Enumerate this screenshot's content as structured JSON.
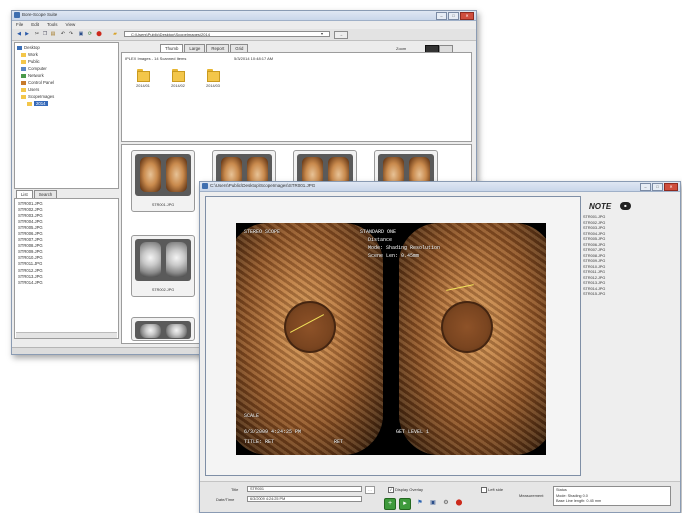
{
  "browser": {
    "title": "Bore-Scope Suite",
    "menu": [
      "File",
      "Edit",
      "Tools",
      "View"
    ],
    "path": "C:\\Users\\Public\\Desktop\\ScopeImages\\2014",
    "tabs": [
      "Thumb",
      "Large",
      "Report",
      "Grid"
    ],
    "status_line": "IPLEX Images - 14 Scanned Items",
    "timestamp": "5/3/2014 10:48:17 AM",
    "view_label": "Zoom",
    "tree": [
      "Desktop",
      "Work",
      "Public",
      "Computer",
      "Network",
      "Control Panel",
      "Users",
      "ScopeImages",
      "2014"
    ],
    "left_tabs": [
      "List",
      "Search"
    ],
    "file_list": [
      "STR001.JPG",
      "STR002.JPG",
      "STR003.JPG",
      "STR004.JPG",
      "STR005.JPG",
      "STR006.JPG",
      "STR007.JPG",
      "STR008.JPG",
      "STR009.JPG",
      "STR010.JPG",
      "STR011.JPG",
      "STR012.JPG",
      "STR013.JPG",
      "STR014.JPG"
    ],
    "folders": [
      "2014/01",
      "2014/02",
      "2014/03"
    ],
    "thumbs": [
      "STR001.JPG",
      "",
      "",
      "",
      "STR002.JPG",
      ""
    ]
  },
  "viewer": {
    "title": "C:\\Users\\Public\\Desktop\\ScopeImages\\STR001.JPG",
    "note_title": "NOTE",
    "note_items": [
      "STR001.JPG",
      "STR002.JPG",
      "STR003.JPG",
      "STR004.JPG",
      "STR005.JPG",
      "STR006.JPG",
      "STR007.JPG",
      "STR008.JPG",
      "STR009.JPG",
      "STR010.JPG",
      "STR011.JPG",
      "STR012.JPG",
      "STR013.JPG",
      "STR014.JPG",
      "STR015.JPG"
    ],
    "overlay": {
      "top_left": "STEREO SCOPE",
      "top_right": "STANDARD ONE",
      "line1": "Distance",
      "line2": "Mode: Shading Resolution",
      "line3": "Scene Len: 0.45mm",
      "bottom1": "SCALE",
      "bottom2": "6/3/2009 4:24:25 PM",
      "bottom3": "TITLE: RET",
      "bottom3b": "RET",
      "bottom_right": "GET LEVEL 1"
    },
    "form": {
      "title_label": "Title",
      "title_value": "STR001",
      "date_label": "Date/Time",
      "date_value": "6/3/2009 4:24:25 PM",
      "zoom_check": "Display Overlay",
      "left_check": "Left side",
      "meas_label": "Measurement",
      "meas_lines": [
        "Status",
        "Mode: Shading 0.0",
        "Base Line length: 0.45 mm"
      ]
    }
  },
  "colors": {
    "folder": "#f3c64a",
    "accent_green": "#3e9a3c",
    "close_red": "#cf4d3d"
  }
}
